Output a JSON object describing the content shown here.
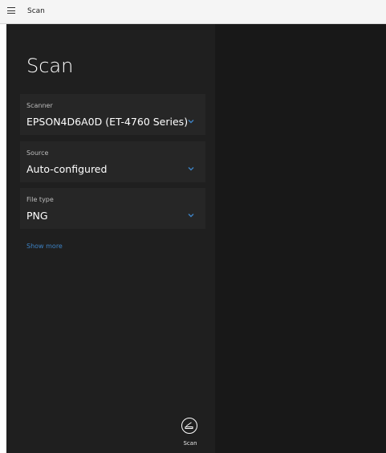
{
  "titlebar": {
    "title": "Scan",
    "menu_icon": "hamburger-icon"
  },
  "heading": "Scan",
  "scanner": {
    "label": "Scanner",
    "value": "EPSON4D6A0D (ET-4760 Series)"
  },
  "source": {
    "label": "Source",
    "value": "Auto-configured"
  },
  "file_type": {
    "label": "File type",
    "value": "PNG"
  },
  "show_more": "Show more",
  "scan_button": {
    "label": "Scan",
    "icon": "scanner-icon"
  },
  "colors": {
    "accent": "#3d82c4",
    "pane": "#1f1f1f",
    "card": "#262626",
    "preview": "#181818"
  }
}
